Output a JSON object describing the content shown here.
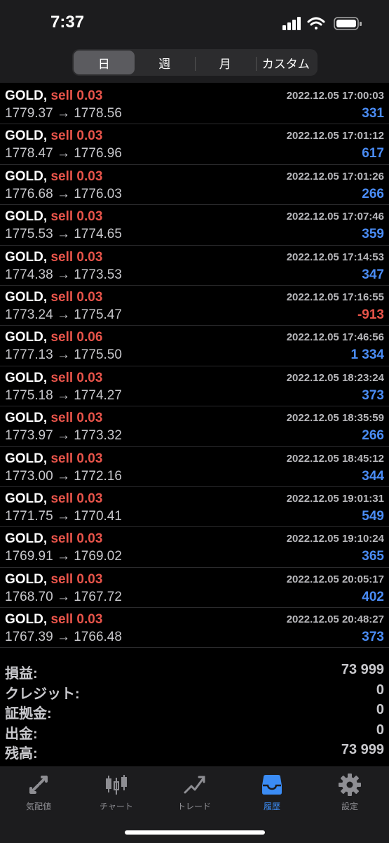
{
  "status": {
    "time": "7:37"
  },
  "tabs": [
    {
      "label": "日",
      "active": true
    },
    {
      "label": "週",
      "active": false
    },
    {
      "label": "月",
      "active": false
    },
    {
      "label": "カスタム",
      "active": false
    }
  ],
  "trades": [
    {
      "symbol": "GOLD,",
      "side": "sell 0.03",
      "time": "2022.12.05 17:00:03",
      "prices": "1779.37 → 1778.56",
      "profit": "331"
    },
    {
      "symbol": "GOLD,",
      "side": "sell 0.03",
      "time": "2022.12.05 17:01:12",
      "prices": "1778.47 → 1776.96",
      "profit": "617"
    },
    {
      "symbol": "GOLD,",
      "side": "sell 0.03",
      "time": "2022.12.05 17:01:26",
      "prices": "1776.68 → 1776.03",
      "profit": "266"
    },
    {
      "symbol": "GOLD,",
      "side": "sell 0.03",
      "time": "2022.12.05 17:07:46",
      "prices": "1775.53 → 1774.65",
      "profit": "359"
    },
    {
      "symbol": "GOLD,",
      "side": "sell 0.03",
      "time": "2022.12.05 17:14:53",
      "prices": "1774.38 → 1773.53",
      "profit": "347"
    },
    {
      "symbol": "GOLD,",
      "side": "sell 0.03",
      "time": "2022.12.05 17:16:55",
      "prices": "1773.24 → 1775.47",
      "profit": "-913"
    },
    {
      "symbol": "GOLD,",
      "side": "sell 0.06",
      "time": "2022.12.05 17:46:56",
      "prices": "1777.13 → 1775.50",
      "profit": "1 334"
    },
    {
      "symbol": "GOLD,",
      "side": "sell 0.03",
      "time": "2022.12.05 18:23:24",
      "prices": "1775.18 → 1774.27",
      "profit": "373"
    },
    {
      "symbol": "GOLD,",
      "side": "sell 0.03",
      "time": "2022.12.05 18:35:59",
      "prices": "1773.97 → 1773.32",
      "profit": "266"
    },
    {
      "symbol": "GOLD,",
      "side": "sell 0.03",
      "time": "2022.12.05 18:45:12",
      "prices": "1773.00 → 1772.16",
      "profit": "344"
    },
    {
      "symbol": "GOLD,",
      "side": "sell 0.03",
      "time": "2022.12.05 19:01:31",
      "prices": "1771.75 → 1770.41",
      "profit": "549"
    },
    {
      "symbol": "GOLD,",
      "side": "sell 0.03",
      "time": "2022.12.05 19:10:24",
      "prices": "1769.91 → 1769.02",
      "profit": "365"
    },
    {
      "symbol": "GOLD,",
      "side": "sell 0.03",
      "time": "2022.12.05 20:05:17",
      "prices": "1768.70 → 1767.72",
      "profit": "402"
    },
    {
      "symbol": "GOLD,",
      "side": "sell 0.03",
      "time": "2022.12.05 20:48:27",
      "prices": "1767.39 → 1766.48",
      "profit": "373"
    }
  ],
  "summary": [
    {
      "label": "損益:",
      "value": "73 999"
    },
    {
      "label": "クレジット:",
      "value": "0"
    },
    {
      "label": "証拠金:",
      "value": "0"
    },
    {
      "label": "出金:",
      "value": "0"
    },
    {
      "label": "残高:",
      "value": "73 999"
    }
  ],
  "nav": [
    {
      "label": "気配値",
      "icon": "quotes-icon",
      "active": false
    },
    {
      "label": "チャート",
      "icon": "candlestick-icon",
      "active": false
    },
    {
      "label": "トレード",
      "icon": "trade-icon",
      "active": false
    },
    {
      "label": "履歴",
      "icon": "history-inbox-icon",
      "active": true
    },
    {
      "label": "設定",
      "icon": "gear-icon",
      "active": false
    }
  ],
  "colors": {
    "sell": "#e8544a",
    "profit_positive": "#4a8cf5",
    "profit_negative": "#e8544a",
    "active_tab": "#3b8cf5"
  }
}
